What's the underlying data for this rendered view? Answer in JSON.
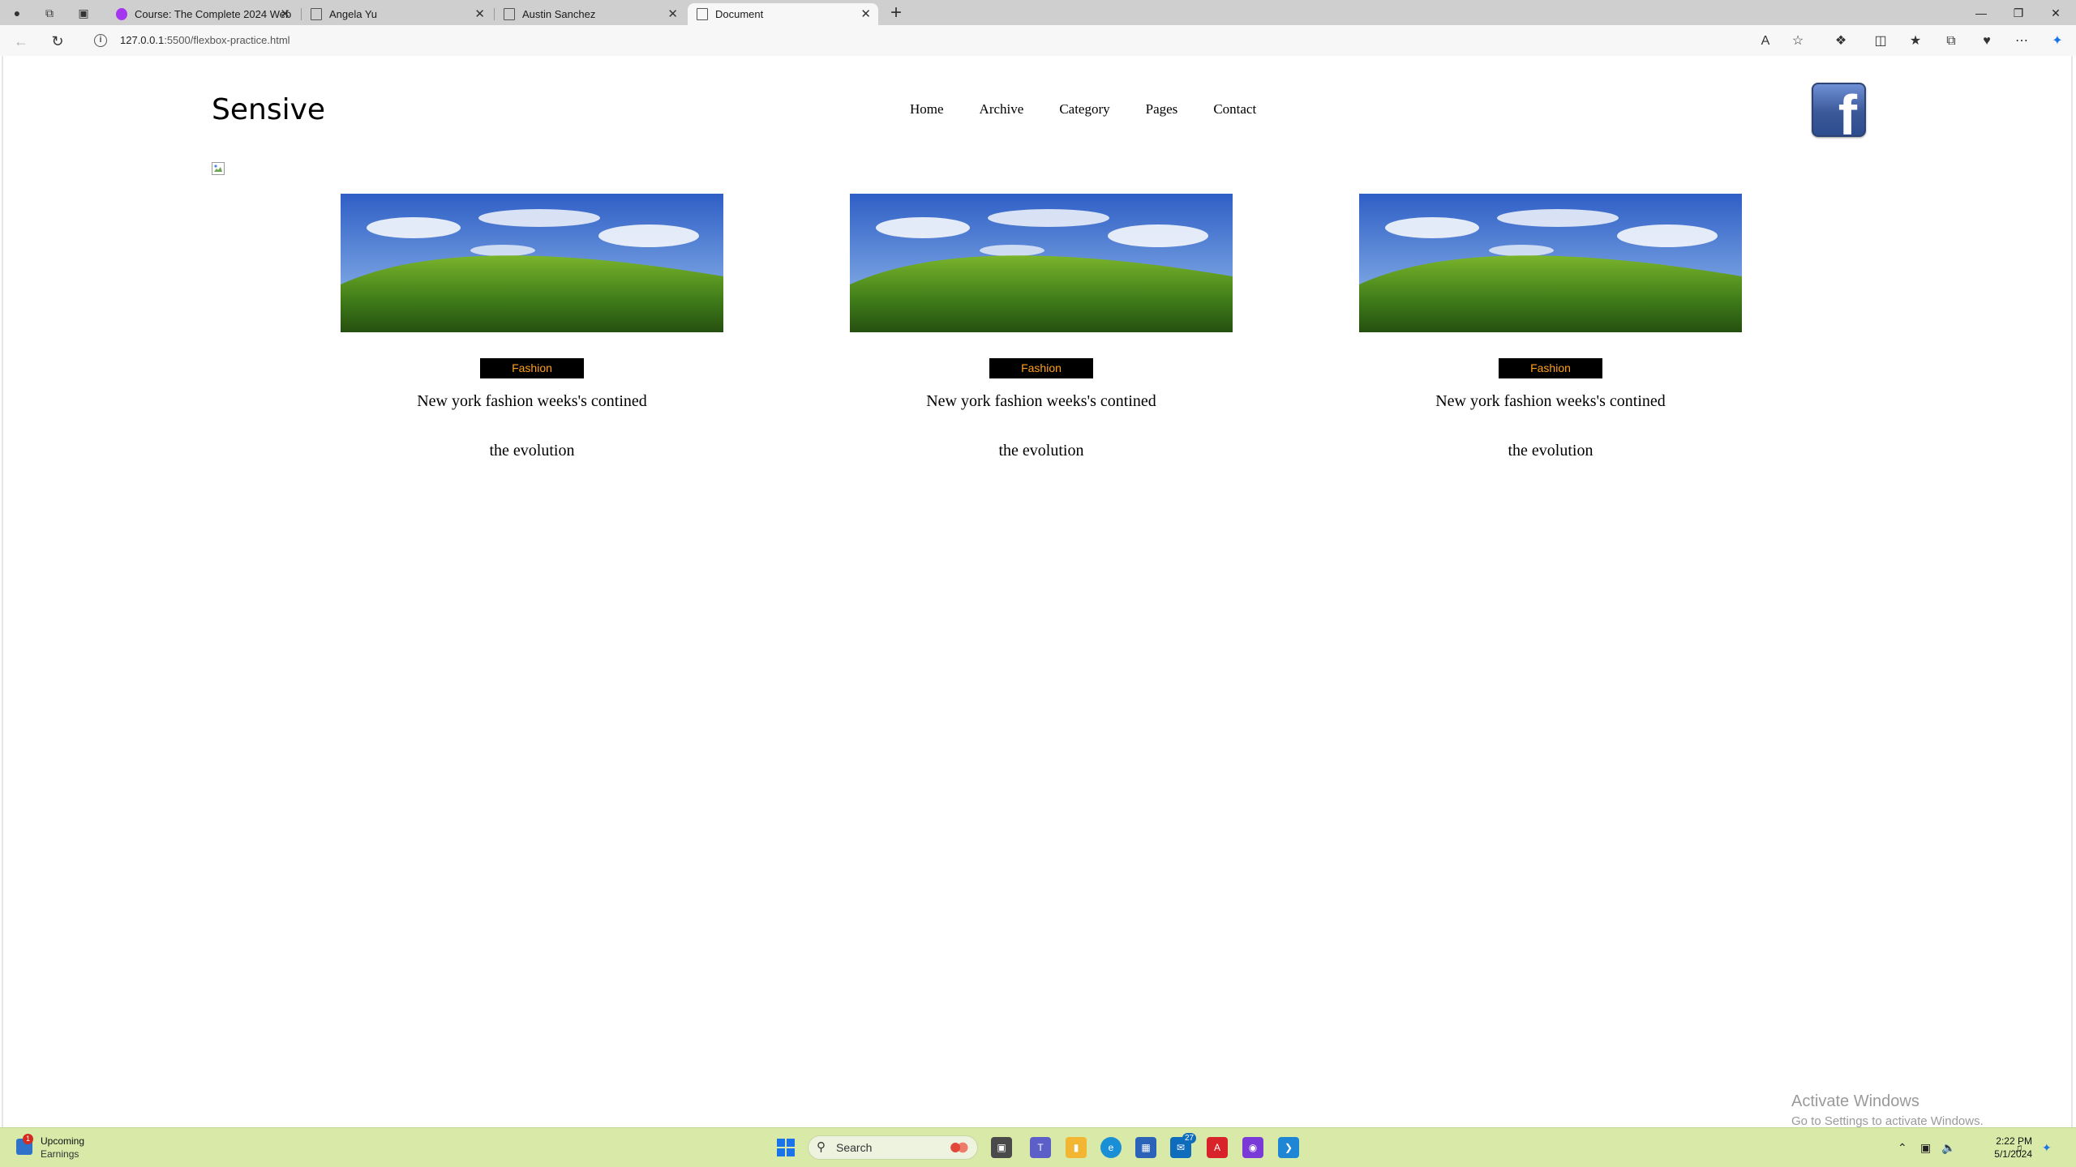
{
  "browser": {
    "tabs": [
      {
        "title": "Course: The Complete 2024 Web",
        "active": false,
        "favicon": "udemy-icon"
      },
      {
        "title": "Angela Yu",
        "active": false,
        "favicon": "page-icon"
      },
      {
        "title": "Austin Sanchez",
        "active": false,
        "favicon": "page-icon"
      },
      {
        "title": "Document",
        "active": true,
        "favicon": "page-icon"
      }
    ],
    "address": {
      "host": "127.0.0.1",
      "path": ":5500/flexbox-practice.html"
    }
  },
  "page": {
    "logo": "Sensive",
    "nav": [
      "Home",
      "Archive",
      "Category",
      "Pages",
      "Contact"
    ],
    "cards": [
      {
        "badge": "Fashion",
        "title": "New york fashion weeks's contined",
        "subtitle": "the evolution"
      },
      {
        "badge": "Fashion",
        "title": "New york fashion weeks's contined",
        "subtitle": "the evolution"
      },
      {
        "badge": "Fashion",
        "title": "New york fashion weeks's contined",
        "subtitle": "the evolution"
      }
    ],
    "badge_text_color": "#ff9f1c"
  },
  "watermark": {
    "line1": "Activate Windows",
    "line2": "Go to Settings to activate Windows."
  },
  "taskbar": {
    "widget": {
      "title": "Upcoming",
      "subtitle": "Earnings",
      "badge": "1"
    },
    "search_placeholder": "Search",
    "mail_badge": "27",
    "clock": {
      "time": "2:22 PM",
      "date": "5/1/2024"
    }
  }
}
